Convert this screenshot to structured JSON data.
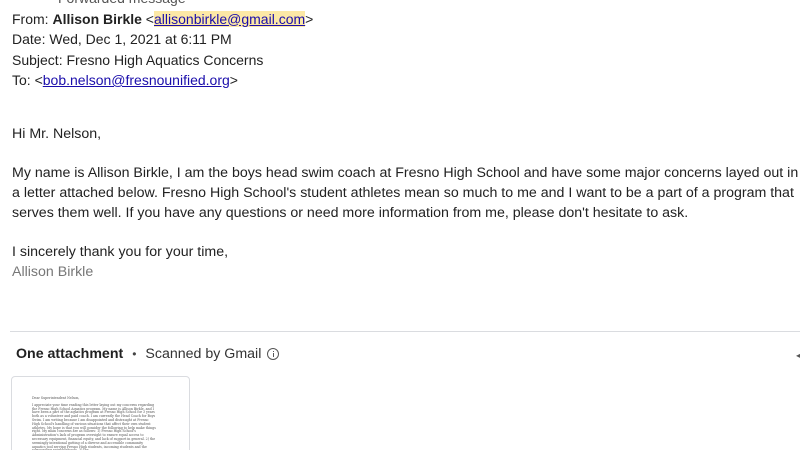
{
  "header": {
    "forwarded_label": "Forwarded message",
    "from_label": "From:",
    "from_name": "Allison Birkle",
    "from_email": "allisonbirkle@gmail.com",
    "date_line": "Date: Wed, Dec 1, 2021 at 6:11 PM",
    "subject_line": "Subject: Fresno High Aquatics Concerns",
    "to_label": "To:",
    "to_email": "bob.nelson@fresnounified.org"
  },
  "body": {
    "greeting": "Hi Mr. Nelson,",
    "paragraph": "My name is Allison Birkle, I am the boys head swim coach at Fresno High School and have some major concerns layed out in a letter attached below. Fresno High School's student athletes mean so much to me and I want to be a part of a program that serves them well. If you have any questions or need more information from me, please don't hesitate to ask.",
    "signoff": "I sincerely thank you for your time,",
    "signature": "Allison Birkle"
  },
  "attachments": {
    "title": "One attachment",
    "separator": "•",
    "scan_status": "Scanned by Gmail",
    "info_icon": "info-icon",
    "preview": {
      "greeting": "Dear Superintendent Nelson,",
      "text": "I appreciate your time reading this letter laying out my concerns regarding the Fresno High School Aquatics program. My name is Allison Birkle, and I have been a part of the aquatics program at Fresno High School for 3 years both as a volunteer and paid coach. I am currently the Head Coach for Boys Swim. I am writing because I am disappointed and distraught at Fresno High School's handling of various situations that affect their own student athletes. My hope is that you will consider the following to help make things right. My main concerns are as follows: 1) Fresno High School's Administration's lack of program oversight to ensure equal access to necessary equipment, financial equity, and lack of support in general. 2) the seemingly intentional gutting of a diverse and accessible community aquatics tool serving Fresno High students, incoming students and the surrounding neighborhoods. 3) the"
    }
  },
  "colors": {
    "link": "#1a0dab",
    "highlight": "#fce8a6",
    "signature": "#777777",
    "divider": "#dadce0"
  }
}
